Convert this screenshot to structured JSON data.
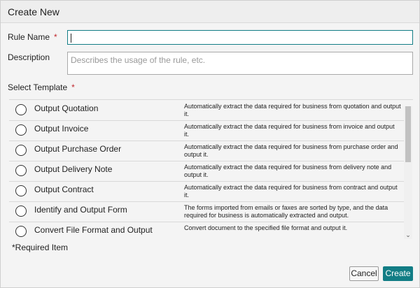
{
  "dialog": {
    "title": "Create New"
  },
  "form": {
    "rule_name_label": "Rule Name",
    "required_mark": "*",
    "rule_name_value": "",
    "description_label": "Description",
    "description_placeholder": "Describes the usage of the rule, etc.",
    "template_label": "Select Template"
  },
  "templates": [
    {
      "name": "Output Quotation",
      "description": "Automatically extract the data required for business from quotation and output it."
    },
    {
      "name": "Output Invoice",
      "description": "Automatically extract the data required for business from invoice and output it."
    },
    {
      "name": "Output Purchase Order",
      "description": "Automatically extract the data required for business from purchase order and output it."
    },
    {
      "name": "Output Delivery Note",
      "description": "Automatically extract the data required for business from delivery note and output it."
    },
    {
      "name": "Output Contract",
      "description": "Automatically extract the data required for business from contract and output it."
    },
    {
      "name": "Identify and Output Form",
      "description": "The forms imported from emails or faxes are sorted by type, and the data required for business is automatically extracted and output."
    },
    {
      "name": "Convert File Format and Output",
      "description": "Convert document to the specified file format and output it."
    }
  ],
  "footer": {
    "required_note": "*Required Item",
    "cancel_label": "Cancel",
    "create_label": "Create"
  },
  "colors": {
    "accent": "#127d85",
    "required": "#c0272d"
  }
}
